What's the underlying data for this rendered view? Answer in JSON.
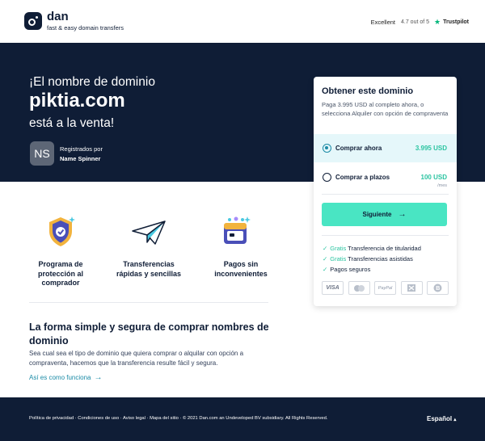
{
  "header": {
    "brand_name": "dan",
    "brand_tagline": "fast & easy domain transfers",
    "trust_label": "Excellent",
    "trust_score": "4.7 out of 5",
    "trust_brand": "Trustpilot"
  },
  "hero": {
    "title": "¡El nombre de dominio",
    "domain": "piktia.com",
    "subtitle": "está a la venta!",
    "avatar_initials": "NS",
    "registered_label": "Registrados por",
    "registrar": "Name Spinner"
  },
  "card": {
    "title": "Obtener este dominio",
    "description": "Paga 3.995 USD al completo ahora, o selecciona Alquiler con opción de compraventa",
    "options": [
      {
        "label": "Comprar ahora",
        "price": "3.995 USD",
        "selected": true
      },
      {
        "label": "Comprar a plazos",
        "price": "100 USD",
        "unit": "/mes",
        "selected": false
      }
    ],
    "cta_label": "Siguiente",
    "benefits": [
      {
        "highlight": "Gratis",
        "text": "Transferencia de titularidad"
      },
      {
        "highlight": "Gratis",
        "text": "Transferencias asistidas"
      },
      {
        "highlight": "",
        "text": "Pagos seguros"
      }
    ],
    "payment_methods": [
      {
        "name": "visa-icon",
        "label": "VISA"
      },
      {
        "name": "mastercard-icon",
        "label": ""
      },
      {
        "name": "paypal-icon",
        "label": "PayPal"
      },
      {
        "name": "bank-transfer-icon",
        "label": ""
      },
      {
        "name": "bitcoin-icon",
        "label": ""
      }
    ]
  },
  "features": [
    {
      "label": "Programa de protección al comprador"
    },
    {
      "label": "Transferencias rápidas y sencillas"
    },
    {
      "label": "Pagos sin inconvenientes"
    }
  ],
  "info": {
    "title": "La forma simple y segura de comprar nombres de dominio",
    "body": "Sea cual sea el tipo de dominio que quiera comprar o alquilar con opción a compraventa, hacemos que la transferencia resulte fácil y segura.",
    "link": "Así es como funciona"
  },
  "footer": {
    "links": "Política de privacidad · Condiciones de uso · Aviso legal · Mapa del sitio · © 2021 Dan.com an Undeveloped BV subsidiary. All Rights Reserved.",
    "language": "Español"
  },
  "colors": {
    "navy": "#0f1d36",
    "accent": "#49e5c3",
    "teal": "#2bc4a1",
    "selected_bg": "#e5f7fa"
  }
}
